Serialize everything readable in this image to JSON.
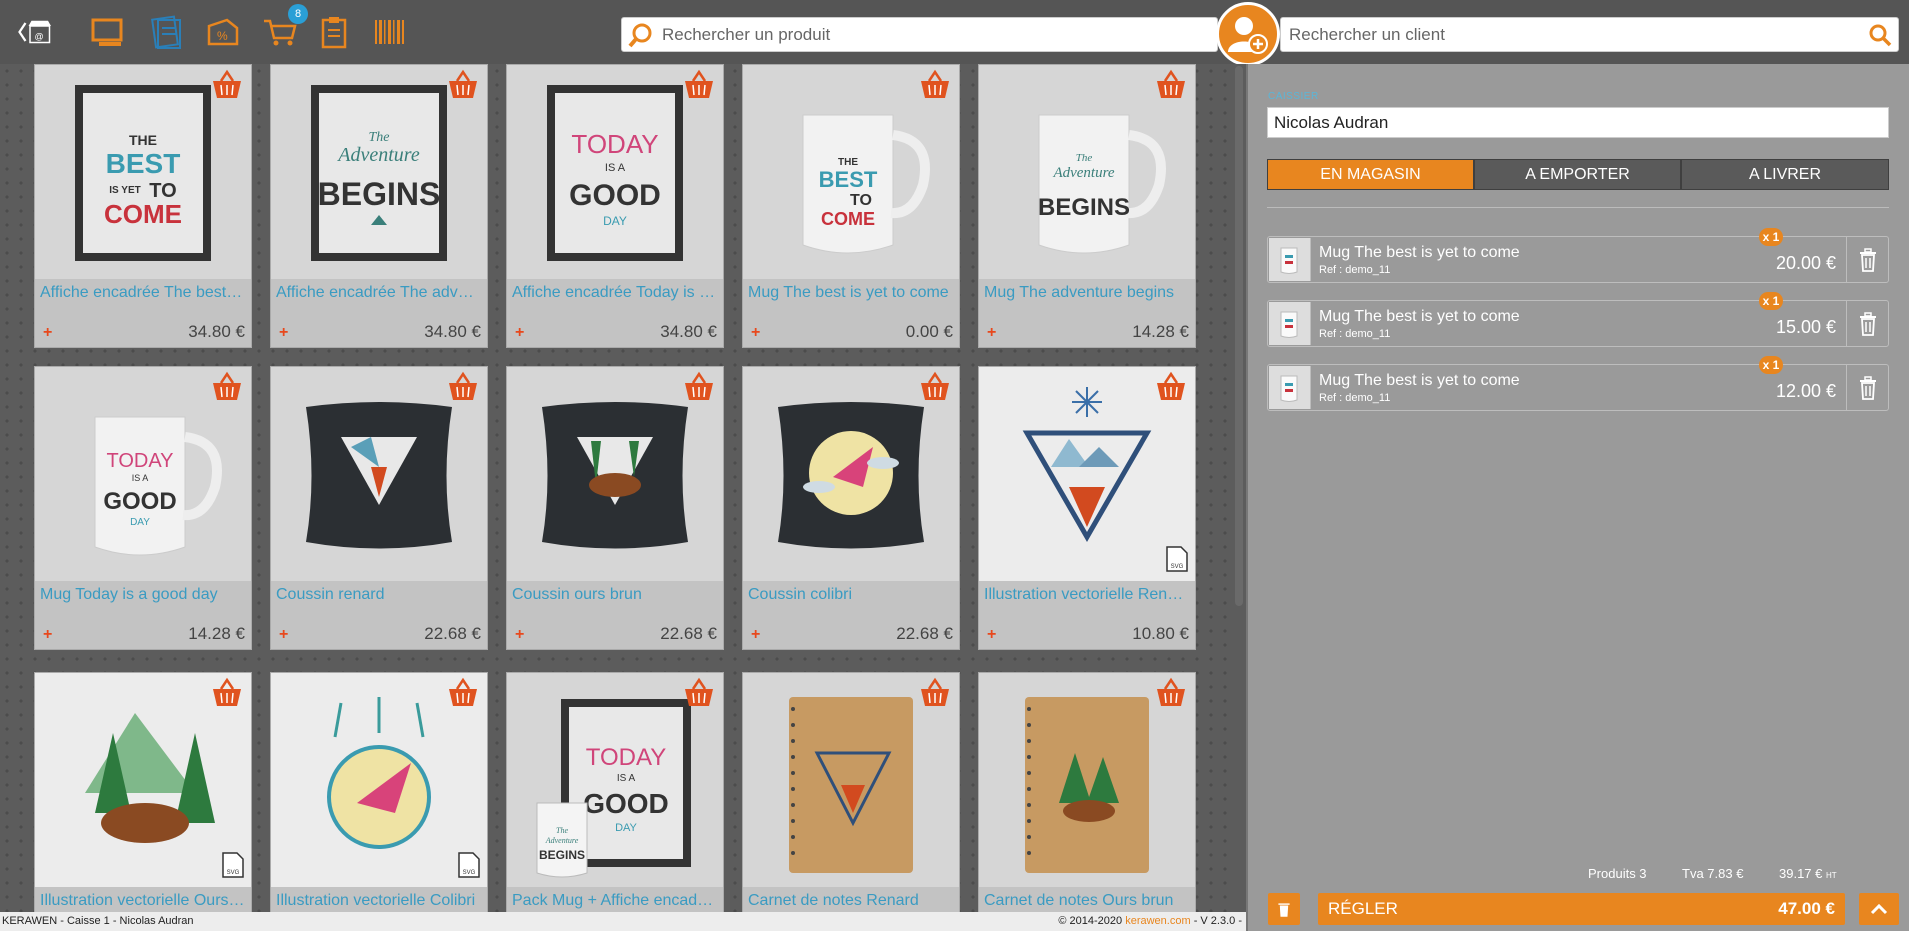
{
  "topbar": {
    "cart_badge": "8",
    "product_search_placeholder": "Rechercher un produit",
    "client_search_placeholder": "Rechercher un client"
  },
  "products": [
    {
      "name": "Affiche encadrée The best is yet to come",
      "price": "34.80 €",
      "plus": "+",
      "image": "framed-poster"
    },
    {
      "name": "Affiche encadrée The adventure begins",
      "price": "34.80 €",
      "plus": "+",
      "image": "framed-poster"
    },
    {
      "name": "Affiche encadrée Today is a good day",
      "price": "34.80 €",
      "plus": "+",
      "image": "framed-poster"
    },
    {
      "name": "Mug The best is yet to come",
      "price": "0.00 €",
      "plus": "+",
      "image": "mug"
    },
    {
      "name": "Mug The adventure begins",
      "price": "14.28 €",
      "plus": "+",
      "image": "mug"
    },
    {
      "name": "Mug Today is a good day",
      "price": "14.28 €",
      "plus": "+",
      "image": "mug"
    },
    {
      "name": "Coussin renard",
      "price": "22.68 €",
      "plus": "+",
      "image": "cushion"
    },
    {
      "name": "Coussin ours brun",
      "price": "22.68 €",
      "plus": "+",
      "image": "cushion"
    },
    {
      "name": "Coussin colibri",
      "price": "22.68 €",
      "plus": "+",
      "image": "cushion"
    },
    {
      "name": "Illustration vectorielle Renard",
      "price": "10.80 €",
      "plus": "+",
      "image": "illustration"
    },
    {
      "name": "Illustration vectorielle Ours brun",
      "price": "",
      "plus": "",
      "image": "illustration"
    },
    {
      "name": "Illustration vectorielle Colibri",
      "price": "",
      "plus": "",
      "image": "illustration"
    },
    {
      "name": "Pack Mug + Affiche encadrée",
      "price": "",
      "plus": "",
      "image": "pack"
    },
    {
      "name": "Carnet de notes Renard",
      "price": "",
      "plus": "",
      "image": "notebook"
    },
    {
      "name": "Carnet de notes Ours brun",
      "price": "",
      "plus": "",
      "image": "notebook"
    }
  ],
  "poster_texts": {
    "best_1": "THE",
    "best_2": "BEST",
    "best_3": "IS YET",
    "best_4": "TO",
    "best_5": "COME",
    "adv_1": "The",
    "adv_2": "Adventure",
    "adv_3": "BEGINS",
    "today_1": "TODAY",
    "today_2": "IS A",
    "today_3": "GOOD",
    "today_4": "DAY",
    "svg": "SVG"
  },
  "panel": {
    "cashier_label": "CAISSIER",
    "cashier_name": "Nicolas Audran",
    "modes": [
      "EN MAGASIN",
      "A EMPORTER",
      "A LIVRER"
    ],
    "active_mode": "EN MAGASIN",
    "lines": [
      {
        "name": "Mug The best is yet to come",
        "ref": "Ref : demo_11",
        "qty": "x 1",
        "price": "20.00 €"
      },
      {
        "name": "Mug The best is yet to come",
        "ref": "Ref : demo_11",
        "qty": "x 1",
        "price": "15.00 €"
      },
      {
        "name": "Mug The best is yet to come",
        "ref": "Ref : demo_11",
        "qty": "x 1",
        "price": "12.00 €"
      }
    ],
    "totals": {
      "products": "Produits 3",
      "tva": "Tva 7.83 €",
      "total_ht": "39.17 €",
      "ht": "HT"
    },
    "pay_label": "RÉGLER",
    "pay_amount": "47.00 €"
  },
  "footer": {
    "left": "KERAWEN - Caisse 1 - Nicolas Audran",
    "copyright": "© 2014-2020 ",
    "brand": "kerawen.com",
    "version": " - V 2.3.0 -"
  },
  "colors": {
    "accent": "#e8861f",
    "link": "#3a9bc2",
    "badge": "#2a9fd6",
    "panel": "#9a9a9a"
  }
}
